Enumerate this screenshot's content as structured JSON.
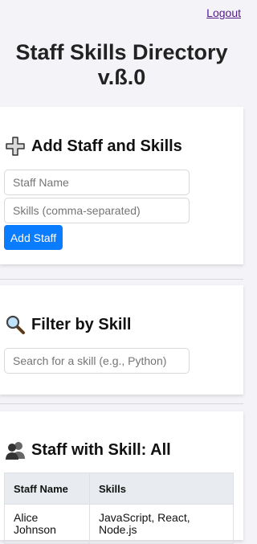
{
  "header": {
    "logout_label": "Logout",
    "title": "Staff Skills Directory v.ß.0"
  },
  "add_section": {
    "heading": "Add Staff and Skills",
    "icon": "plus-icon",
    "name_placeholder": "Staff Name",
    "skills_placeholder": "Skills (comma-separated)",
    "add_label": "Add Staff"
  },
  "filter_section": {
    "heading": "Filter by Skill",
    "icon": "magnifier-icon",
    "search_placeholder": "Search for a skill (e.g., Python)"
  },
  "staff_section": {
    "heading": "Staff with Skill: All",
    "icon": "people-icon",
    "columns": [
      "Staff Name",
      "Skills"
    ],
    "rows": [
      {
        "name": "Alice Johnson",
        "skills": "JavaScript, React, Node.js"
      }
    ]
  },
  "colors": {
    "page_bg": "#f4f4f8",
    "accent": "#0a7cff",
    "link": "#551a8b"
  }
}
